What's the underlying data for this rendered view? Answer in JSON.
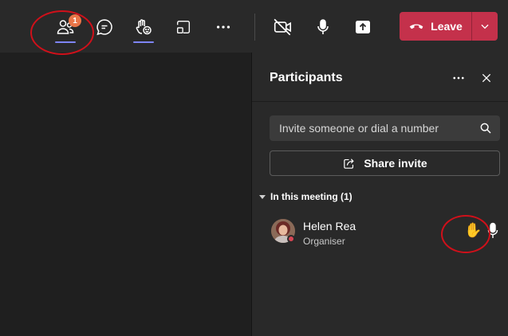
{
  "colors": {
    "accent": "#7f85f5",
    "badge": "#e97548",
    "leave": "#c4314b",
    "presence_busy": "#d74654",
    "hand_raised": "#f8c12d",
    "annotation": "#d0101a"
  },
  "toolbar": {
    "participants_badge": "1",
    "leave_label": "Leave"
  },
  "panel": {
    "title": "Participants",
    "search_placeholder": "Invite someone or dial a number",
    "share_label": "Share invite",
    "section_label": "In this meeting (1)",
    "participants": [
      {
        "name": "Helen Rea",
        "role": "Organiser",
        "hand_raised": true
      }
    ]
  }
}
